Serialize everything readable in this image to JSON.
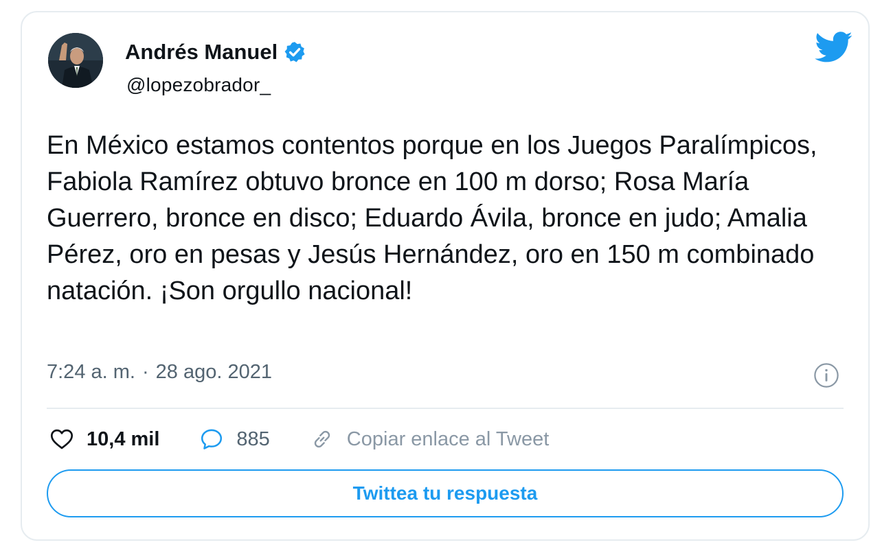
{
  "author": {
    "display_name": "Andrés Manuel",
    "handle": "@lopezobrador_",
    "verified": true
  },
  "tweet": {
    "text": "En México estamos contentos porque en los Juegos Paralímpicos, Fabiola Ramírez obtuvo bronce en 100 m dorso; Rosa María Guerrero, bronce en disco; Eduardo Ávila, bronce en judo; Amalia Pérez, oro en pesas y Jesús Hernández, oro en 150 m combinado natación. ¡Son orgullo nacional!",
    "time": "7:24 a. m.",
    "separator": "·",
    "date": "28 ago. 2021"
  },
  "actions": {
    "like_count": "10,4 mil",
    "reply_count": "885",
    "copy_link_label": "Copiar enlace al Tweet"
  },
  "reply_button_label": "Twittea tu respuesta",
  "icons": {
    "logo": "twitter-bird-icon",
    "verified": "verified-badge-icon",
    "info": "info-icon",
    "like": "heart-icon",
    "reply": "reply-bubble-icon",
    "link": "link-icon"
  },
  "colors": {
    "accent": "#1d9bf0",
    "text": "#0f1419",
    "secondary": "#536471",
    "border": "#e6ecf0"
  }
}
